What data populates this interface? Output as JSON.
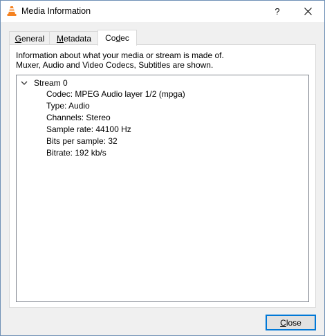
{
  "window": {
    "title": "Media Information",
    "help_label": "?",
    "close_glyph": "✕",
    "icon": "vlc-cone-icon"
  },
  "tabs": [
    {
      "label": "General",
      "mnemonic": "G",
      "rest": "eneral",
      "active": false
    },
    {
      "label": "Metadata",
      "mnemonic": "M",
      "rest": "etadata",
      "active": false
    },
    {
      "label": "Codec",
      "prefix": "Co",
      "mnemonic": "d",
      "rest": "ec",
      "active": true
    }
  ],
  "codec": {
    "description_line1": "Information about what your media or stream is made of.",
    "description_line2": "Muxer, Audio and Video Codecs, Subtitles are shown.",
    "stream": {
      "label": "Stream 0",
      "expanded": true,
      "properties": [
        "Codec: MPEG Audio layer 1/2 (mpga)",
        "Type: Audio",
        "Channels: Stereo",
        "Sample rate: 44100 Hz",
        "Bits per sample: 32",
        "Bitrate: 192 kb/s"
      ]
    }
  },
  "footer": {
    "close_label": "Close",
    "close_mnemonic": "C",
    "close_rest": "lose"
  },
  "colors": {
    "focus_border": "#0078d7",
    "vlc_orange": "#f58220"
  }
}
